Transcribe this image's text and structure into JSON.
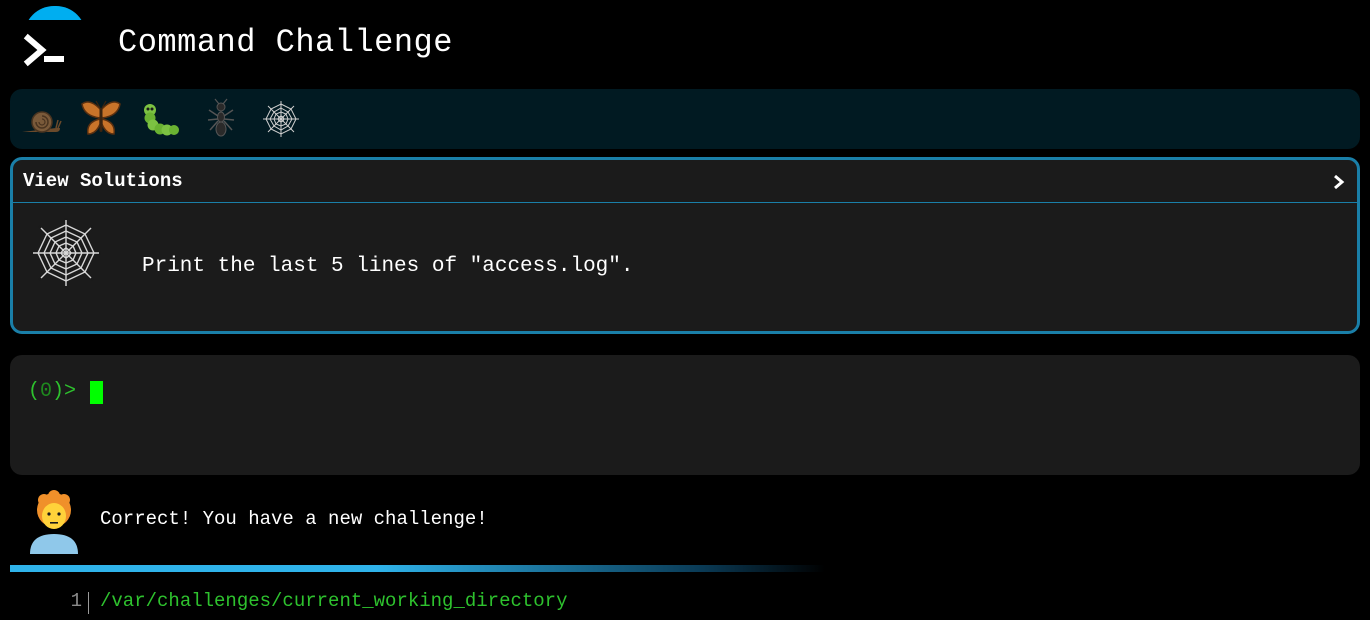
{
  "app": {
    "title": "Command Challenge",
    "logo_icon": "terminal-prompt-icon"
  },
  "levels": [
    {
      "name": "snail",
      "icon": "snail-icon"
    },
    {
      "name": "butterfly",
      "icon": "butterfly-icon"
    },
    {
      "name": "caterpillar",
      "icon": "caterpillar-icon"
    },
    {
      "name": "ant",
      "icon": "ant-icon"
    },
    {
      "name": "spider-web",
      "icon": "spider-web-icon"
    }
  ],
  "challenge": {
    "view_solutions_label": "View Solutions",
    "level_icon": "spider-web-icon",
    "text": "Print the last 5 lines of \"access.log\"."
  },
  "terminal": {
    "prompt_open": "(",
    "prompt_count": "0",
    "prompt_close": ")>"
  },
  "feedback": {
    "avatar_icon": "person-avatar-icon",
    "message": "Correct! You have a new challenge!"
  },
  "output": {
    "lines": [
      {
        "number": "1",
        "text": "/var/challenges/current_working_directory"
      }
    ]
  },
  "colors": {
    "background": "#000000",
    "level_bar": "#011a22",
    "panel": "#1b1b1b",
    "panel_border": "#1a7fa8",
    "prompt_green": "#2ec22e",
    "cursor_green": "#00ff00",
    "logo_blue": "#00aef0"
  }
}
